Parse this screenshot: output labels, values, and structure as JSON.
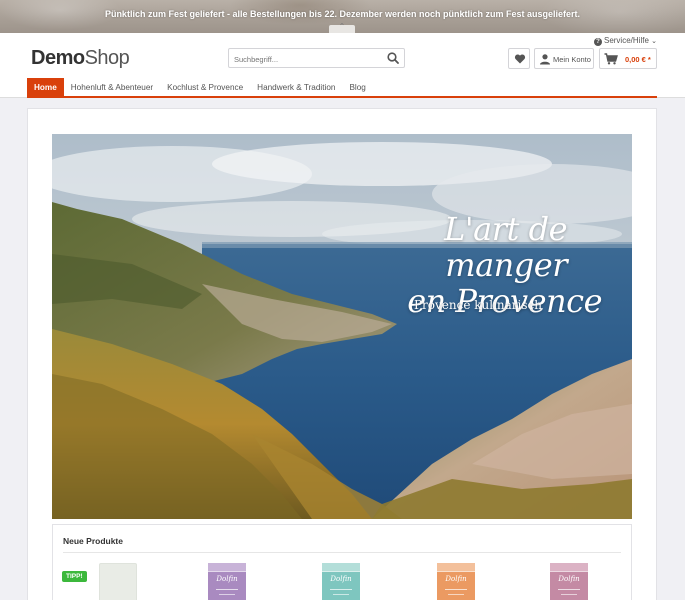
{
  "announcement": {
    "text": "Pünktlich zum Fest geliefert - alle Bestellungen bis 22. Dezember werden noch pünktlich zum Fest ausgeliefert.",
    "collapse_icon": "chevron-up-icon"
  },
  "header": {
    "service_label": "Service/Hilfe",
    "logo_bold": "Demo",
    "logo_thin": "Shop",
    "search_placeholder": "Suchbegriff...",
    "account_label": "Mein Konto",
    "cart_total": "0,00 € *"
  },
  "nav": {
    "items": [
      {
        "label": "Home",
        "active": true
      },
      {
        "label": "Hohenluft & Abenteuer",
        "active": false
      },
      {
        "label": "Kochlust & Provence",
        "active": false
      },
      {
        "label": "Handwerk & Tradition",
        "active": false
      },
      {
        "label": "Blog",
        "active": false
      }
    ]
  },
  "hero": {
    "title_line1": "L'art de manger",
    "title_line2": "en Provence",
    "subtitle": "Provence kulinarisch"
  },
  "products": {
    "title": "Neue Produkte",
    "badge": "TIPP!",
    "items": [
      {
        "brand": "",
        "color": "#e9ece6"
      },
      {
        "brand": "Dolfin",
        "color": "#a98ac0"
      },
      {
        "brand": "Dolfin",
        "color": "#7ec6bf"
      },
      {
        "brand": "Dolfin",
        "color": "#eb9a62"
      },
      {
        "brand": "Dolfin",
        "color": "#c48aa4"
      }
    ]
  },
  "colors": {
    "accent": "#d9400b",
    "badge_green": "#3cb83c"
  }
}
